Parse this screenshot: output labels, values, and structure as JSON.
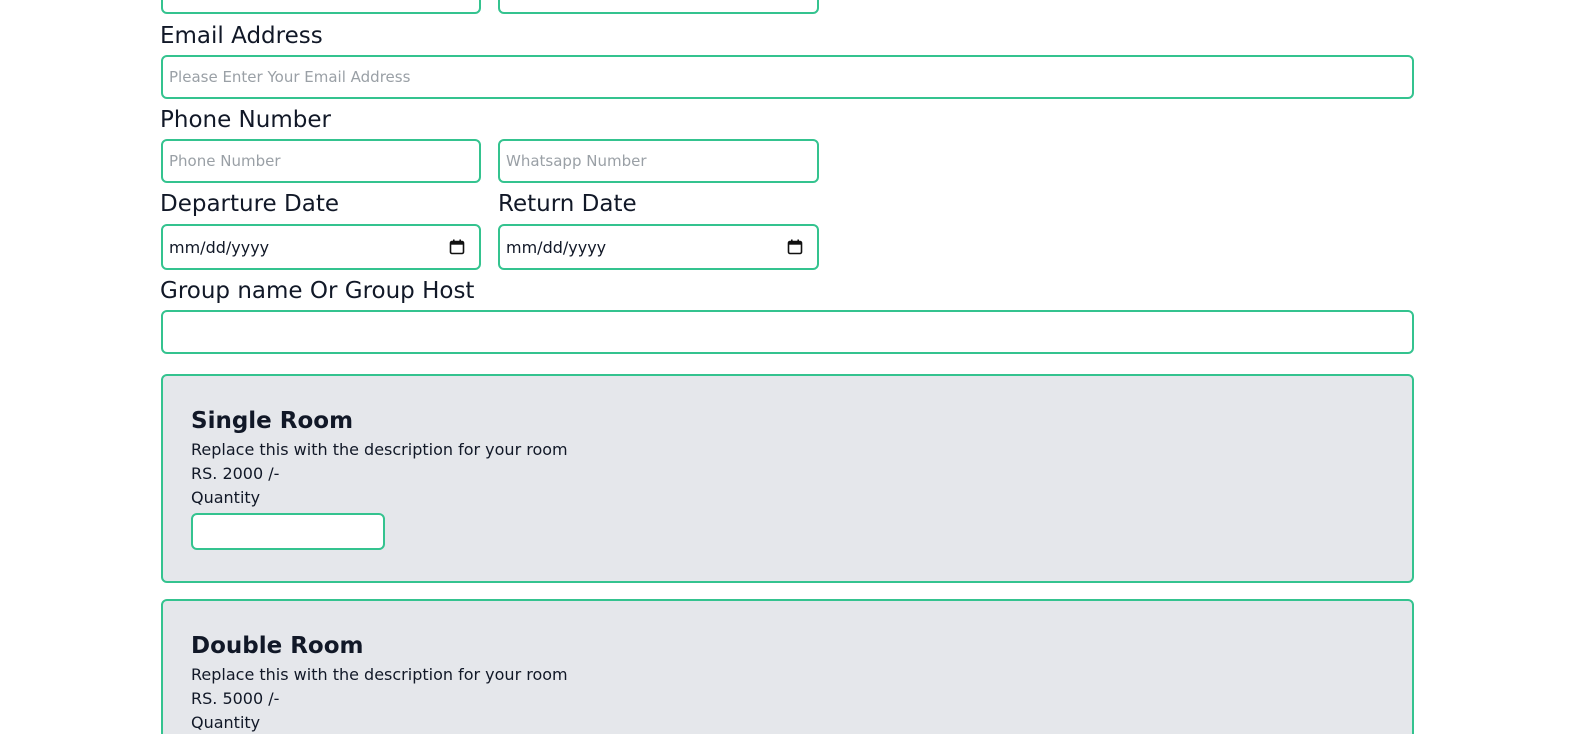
{
  "form": {
    "email": {
      "label": "Email Address",
      "placeholder": "Please Enter Your Email Address"
    },
    "phone": {
      "label": "Phone Number",
      "phone_placeholder": "Phone Number",
      "whatsapp_placeholder": "Whatsapp Number"
    },
    "departure": {
      "label": "Departure Date",
      "value": "mm/dd/yyyy"
    },
    "return": {
      "label": "Return Date",
      "value": "mm/dd/yyyy"
    },
    "group": {
      "label": "Group name Or Group Host",
      "value": ""
    }
  },
  "rooms": [
    {
      "title": "Single Room",
      "description": "Replace this with the description for your room",
      "price": "RS. 2000 /-",
      "quantity_label": "Quantity"
    },
    {
      "title": "Double Room",
      "description": "Replace this with the description for your room",
      "price": "RS. 5000 /-",
      "quantity_label": "Quantity"
    }
  ],
  "theme": {
    "accent": "#34c38f",
    "card_bg": "#e5e7eb"
  },
  "icons": {
    "date_picker": "calendar-icon"
  }
}
